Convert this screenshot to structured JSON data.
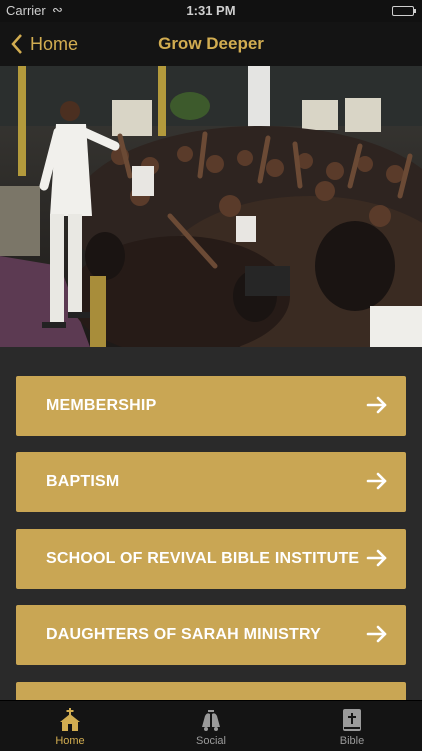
{
  "status_bar": {
    "carrier": "Carrier",
    "time": "1:31 PM"
  },
  "nav": {
    "back_label": "Home",
    "title": "Grow Deeper"
  },
  "menu": {
    "items": [
      {
        "label": "MEMBERSHIP"
      },
      {
        "label": "BAPTISM"
      },
      {
        "label": "SCHOOL OF REVIVAL BIBLE INSTITUTE"
      },
      {
        "label": "DAUGHTERS OF SARAH MINISTRY"
      }
    ]
  },
  "tabs": [
    {
      "label": "Home",
      "icon": "church-icon",
      "active": true
    },
    {
      "label": "Social",
      "icon": "bells-icon",
      "active": false
    },
    {
      "label": "Bible",
      "icon": "bible-icon",
      "active": false
    }
  ],
  "colors": {
    "accent": "#d2ad51",
    "button": "#c9a654",
    "background": "#2a2a2a",
    "bar": "#141414"
  }
}
